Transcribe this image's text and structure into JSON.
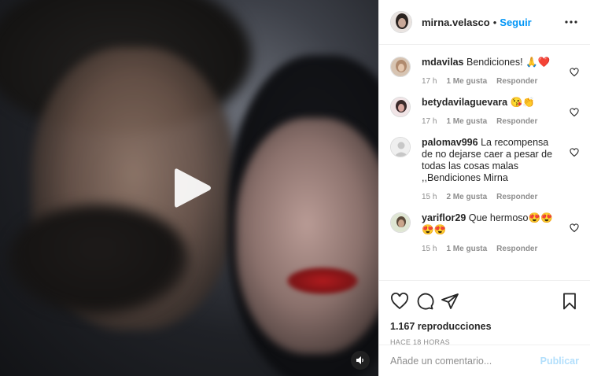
{
  "post": {
    "username": "mirna.velasco",
    "dot": "•",
    "follow_label": "Seguir"
  },
  "comments": [
    {
      "user": "mdavilas",
      "text": "Bendiciones! 🙏❤️",
      "time": "17 h",
      "likes": "1 Me gusta",
      "reply": "Responder"
    },
    {
      "user": "betydavilaguevara",
      "text": "😘👏",
      "time": "17 h",
      "likes": "1 Me gusta",
      "reply": "Responder"
    },
    {
      "user": "palomav996",
      "text": "La recompensa de no dejarse caer a pesar de todas las cosas malas ,,Bendiciones Mirna",
      "time": "15 h",
      "likes": "2 Me gusta",
      "reply": "Responder"
    },
    {
      "user": "yariflor29",
      "text": "Que hermoso😍😍😍😍",
      "time": "15 h",
      "likes": "1 Me gusta",
      "reply": "Responder"
    }
  ],
  "stats": {
    "views": "1.167 reproducciones",
    "time_ago": "HACE 18 HORAS"
  },
  "composer": {
    "placeholder": "Añade un comentario...",
    "publish_label": "Publicar"
  },
  "colors": {
    "accent": "#0095f6",
    "publish_disabled": "#b2dffc",
    "heart": "#ed4956"
  },
  "icons": [
    "play-icon",
    "volume-icon",
    "more-icon",
    "heart-icon",
    "comment-icon",
    "share-icon",
    "bookmark-icon"
  ]
}
